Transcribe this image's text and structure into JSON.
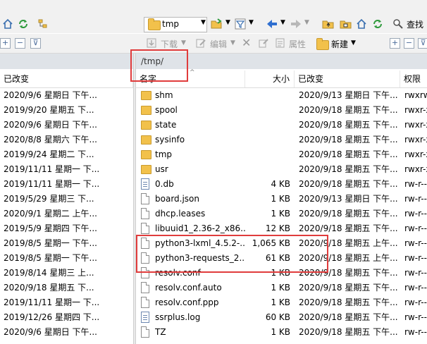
{
  "toolbar1": {
    "location_value": "tmp",
    "find_label": "查找"
  },
  "toolbar2": {
    "download_label": "下载",
    "edit_label": "编辑",
    "properties_label": "属性",
    "new_label": "新建"
  },
  "remote_path": "/tmp/",
  "left_header": {
    "modified": "已改变"
  },
  "right_header": {
    "name": "名字",
    "size": "大小",
    "modified": "已改变",
    "perms": "权限"
  },
  "left_rows": [
    "2020/9/6 星期日  下午...",
    "2019/9/20 星期五  下...",
    "2020/9/6 星期日  下午...",
    "2020/8/8 星期六  下午...",
    "2019/9/24 星期二  下...",
    "2019/11/11 星期一  下...",
    "2019/11/11 星期一  下...",
    "2019/5/29 星期三  下...",
    "2020/9/1 星期二  上午...",
    "2019/5/9 星期四  下午...",
    "2019/8/5 星期一  下午...",
    "2019/8/5 星期一  下午...",
    "2019/8/14 星期三  上...",
    "2020/9/18 星期五  下...",
    "2019/11/11 星期一  下...",
    "2019/12/26 星期四  下...",
    "2020/9/6 星期日  下午..."
  ],
  "files": [
    {
      "name": "shm",
      "icon": "folder-icon",
      "size": "",
      "modified": "2020/9/13 星期日  下午...",
      "perms": "rwxrw"
    },
    {
      "name": "spool",
      "icon": "folder-icon",
      "size": "",
      "modified": "2020/9/18 星期五  下午...",
      "perms": "rwxr-x"
    },
    {
      "name": "state",
      "icon": "folder-icon",
      "size": "",
      "modified": "2020/9/18 星期五  下午...",
      "perms": "rwxr-x"
    },
    {
      "name": "sysinfo",
      "icon": "folder-icon",
      "size": "",
      "modified": "2020/9/18 星期五  下午...",
      "perms": "rwxr-x"
    },
    {
      "name": "tmp",
      "icon": "folder-icon",
      "size": "",
      "modified": "2020/9/18 星期五  下午...",
      "perms": "rwxr-x"
    },
    {
      "name": "usr",
      "icon": "folder-icon",
      "size": "",
      "modified": "2020/9/18 星期五  下午...",
      "perms": "rwxr-x"
    },
    {
      "name": "0.db",
      "icon": "db-file-icon",
      "size": "4 KB",
      "modified": "2020/9/18 星期五  下午...",
      "perms": "rw-r--"
    },
    {
      "name": "board.json",
      "icon": "file-icon",
      "size": "1 KB",
      "modified": "2020/9/13 星期日  下午...",
      "perms": "rw-r--"
    },
    {
      "name": "dhcp.leases",
      "icon": "file-icon",
      "size": "1 KB",
      "modified": "2020/9/18 星期五  下午...",
      "perms": "rw-r--"
    },
    {
      "name": "libuuid1_2.36-2_x86...",
      "icon": "file-icon",
      "size": "12 KB",
      "modified": "2020/9/18 星期五  下午...",
      "perms": "rw-r--"
    },
    {
      "name": "python3-lxml_4.5.2-...",
      "icon": "file-icon",
      "size": "1,065 KB",
      "modified": "2020/9/18 星期五  上午...",
      "perms": "rw-r--"
    },
    {
      "name": "python3-requests_2...",
      "icon": "file-icon",
      "size": "61 KB",
      "modified": "2020/9/18 星期五  上午...",
      "perms": "rw-r--"
    },
    {
      "name": "resolv.conf",
      "icon": "file-icon",
      "size": "1 KB",
      "modified": "2020/9/18 星期五  下午...",
      "perms": "rw-r--"
    },
    {
      "name": "resolv.conf.auto",
      "icon": "file-icon",
      "size": "1 KB",
      "modified": "2020/9/18 星期五  下午...",
      "perms": "rw-r--"
    },
    {
      "name": "resolv.conf.ppp",
      "icon": "file-icon",
      "size": "1 KB",
      "modified": "2020/9/18 星期五  下午...",
      "perms": "rw-r--"
    },
    {
      "name": "ssrplus.log",
      "icon": "log-file-icon",
      "size": "60 KB",
      "modified": "2020/9/18 星期五  下午...",
      "perms": "rw-r--"
    },
    {
      "name": "TZ",
      "icon": "file-icon",
      "size": "1 KB",
      "modified": "2020/9/18 星期五  下午...",
      "perms": "rw-r--"
    }
  ],
  "colors": {
    "annotation_red": "#e03c3c",
    "folder_yellow": "#f2c14b",
    "pathbar_bg": "#dfe3e8"
  }
}
